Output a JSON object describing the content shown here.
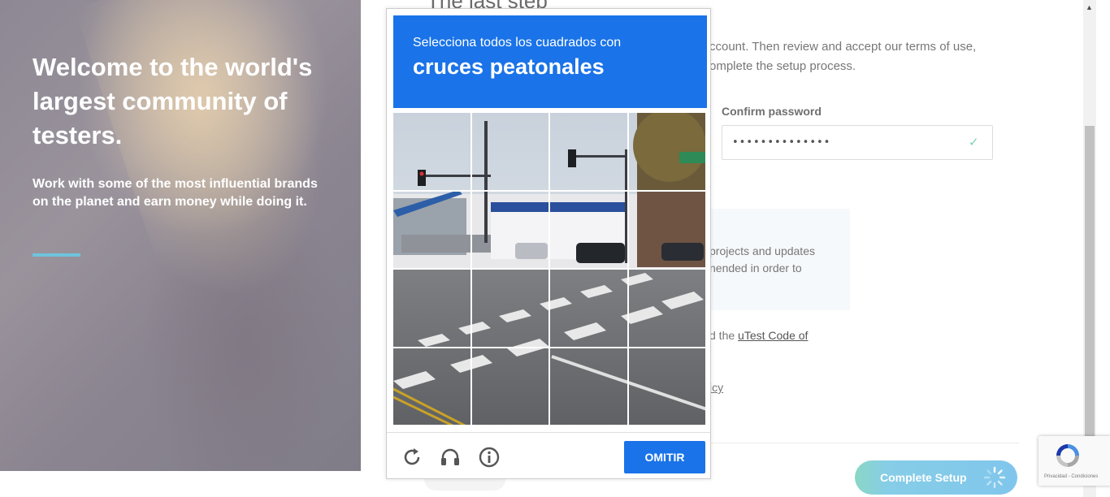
{
  "hero": {
    "title": "Welcome to the world's largest community of testers.",
    "subtitle": "Work with some of the most influential brands on the planet and earn money while doing it.",
    "accent_color": "#6fc3dc"
  },
  "form": {
    "heading": "The last step",
    "intro": "ccount. Then review and accept our terms of use, omplete the setup process.",
    "confirm_password_label": "Confirm password",
    "confirm_password_value": "••••••••••••••",
    "info_text": "projects and updates nended in order to",
    "code_text_prefix": "d the ",
    "code_link": "uTest Code of",
    "policy_text": "icy"
  },
  "actions": {
    "complete_setup_label": "Complete Setup"
  },
  "captcha": {
    "instruction": "Selecciona todos los cuadrados con",
    "target": "cruces peatonales",
    "skip_label": "OMITIR",
    "header_color": "#1a73e8",
    "grid_rows": 4,
    "grid_cols": 4,
    "icons": [
      "reload-icon",
      "audio-icon",
      "info-icon"
    ]
  },
  "recaptcha_badge": {
    "terms": "Privacidad - Condiciones"
  }
}
